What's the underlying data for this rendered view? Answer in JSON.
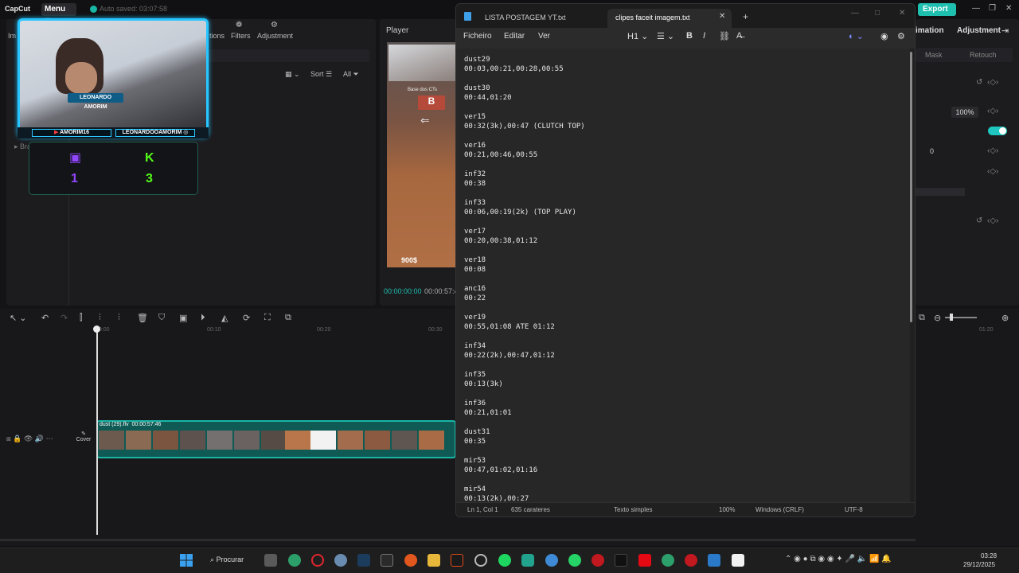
{
  "capcut": {
    "logo": "CapCut",
    "menu_label": "Menu",
    "autosave": "Auto saved: 03:07:58",
    "export_label": "Export",
    "tabs": [
      "Im",
      "tions",
      "Filters",
      "Adjustment"
    ],
    "sort_label": "Sort",
    "all_label": "All",
    "brand_assets": "Brand assets",
    "player_label": "Player",
    "player_time": "00:00:00:00",
    "player_duration": "00:00:57:4",
    "right_tabs": [
      "imation",
      "Adjustment"
    ],
    "right_subtabs": [
      "Mask",
      "Retouch"
    ],
    "zoom_value": "100%",
    "param_value": "0",
    "ruler": [
      "00:00",
      "00:10",
      "00:20",
      "00:30",
      "01:20"
    ],
    "clip_label": "dust (29).flv",
    "clip_duration": "00:00:57:46",
    "cover_label": "Cover"
  },
  "overlay": {
    "cam_name": "LEONARDO AMORIM",
    "handle_left": "AMORIM16",
    "handle_right": "LEONARDOOAMORIM",
    "twitch_count": "1",
    "kick_count": "3",
    "kick_icon": "K",
    "money": "900$",
    "scene_text": "Base dos CTs"
  },
  "notepad": {
    "tab1_title": "LISTA POSTAGEM YT.txt",
    "tab2_title": "clipes faceit imagem.txt",
    "menus": [
      "Ficheiro",
      "Editar",
      "Ver"
    ],
    "heading_tool": "H1",
    "content": "dust29\n00:03,00:21,00:28,00:55\n\ndust30\n00:44,01:20\n\nver15\n00:32(3k),00:47 (CLUTCH TOP)\n\nver16\n00:21,00:46,00:55\n\ninf32\n00:38\n\ninf33\n00:06,00:19(2k) (TOP PLAY)\n\nver17\n00:20,00:38,01:12\n\nver18\n00:08\n\nanc16\n00:22\n\nver19\n00:55,01:08 ATE 01:12\n\ninf34\n00:22(2k),00:47,01:12\n\ninf35\n00:13(3k)\n\ninf36\n00:21,01:01\n\ndust31\n00:35\n\nmir53\n00:47,01:02,01:16\n\nmir54\n00:13(2k),00:27",
    "status": {
      "position": "Ln 1, Col 1",
      "chars": "635 carateres",
      "format": "Texto simples",
      "zoom": "100%",
      "line_ending": "Windows (CRLF)",
      "encoding": "UTF-8"
    }
  },
  "taskbar": {
    "search_label": "Procurar",
    "time": "03:28",
    "date": "29/12/2025"
  },
  "colors": {
    "accent": "#1fbfb0",
    "cam_border": "#29c5ff",
    "twitch": "#9146ff",
    "kick": "#53fc18"
  }
}
